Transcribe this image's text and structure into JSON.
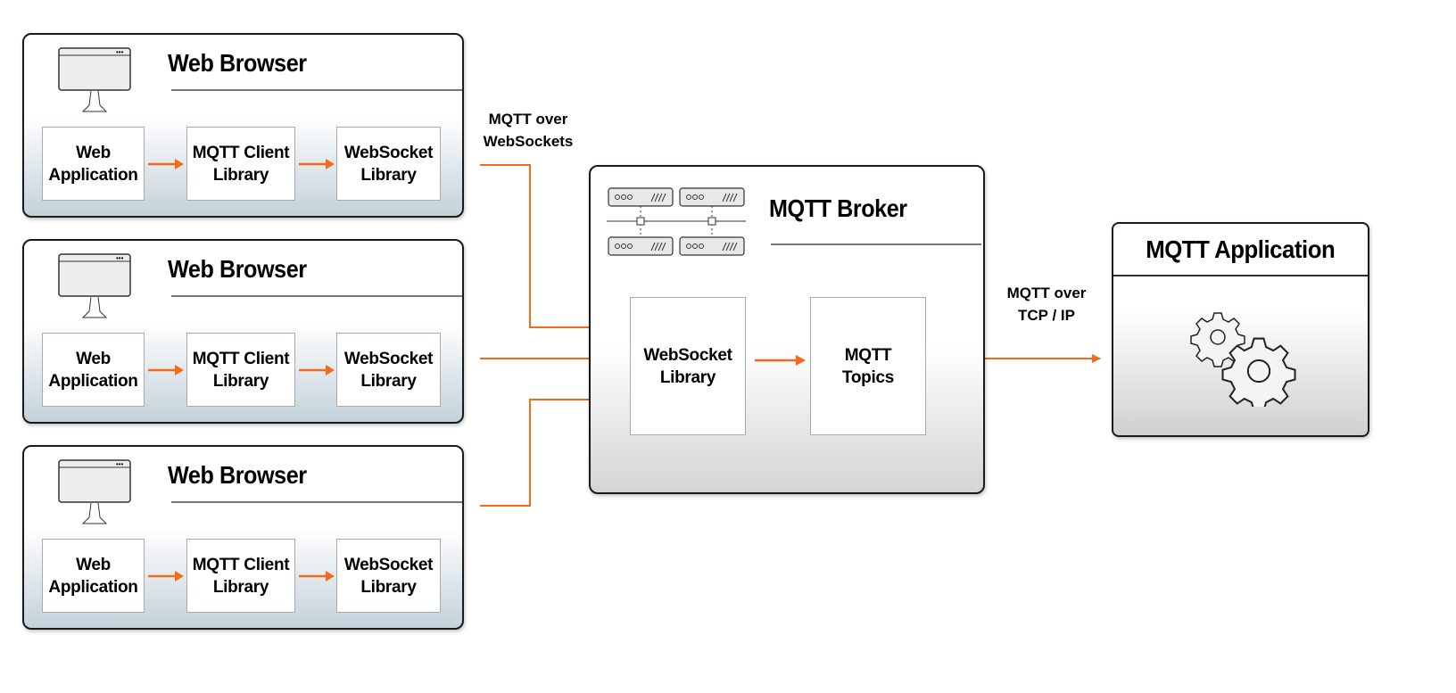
{
  "browsers": [
    {
      "title": "Web Browser",
      "boxes": [
        "Web\nApplication",
        "MQTT Client\nLibrary",
        "WebSocket\nLibrary"
      ]
    },
    {
      "title": "Web Browser",
      "boxes": [
        "Web\nApplication",
        "MQTT Client\nLibrary",
        "WebSocket\nLibrary"
      ]
    },
    {
      "title": "Web Browser",
      "boxes": [
        "Web\nApplication",
        "MQTT Client\nLibrary",
        "WebSocket\nLibrary"
      ]
    }
  ],
  "broker": {
    "title": "MQTT Broker",
    "websocket": "WebSocket\nLibrary",
    "topics": "MQTT\nTopics"
  },
  "application": {
    "title": "MQTT Application"
  },
  "labels": {
    "websockets": "MQTT over\nWebSockets",
    "tcp": "MQTT over\nTCP / IP"
  },
  "colors": {
    "arrow": "#f26a1b",
    "browser_gradient_bottom": "#c3d1da"
  },
  "icons": [
    "monitor-icon",
    "server-cluster-icon",
    "gears-icon"
  ]
}
